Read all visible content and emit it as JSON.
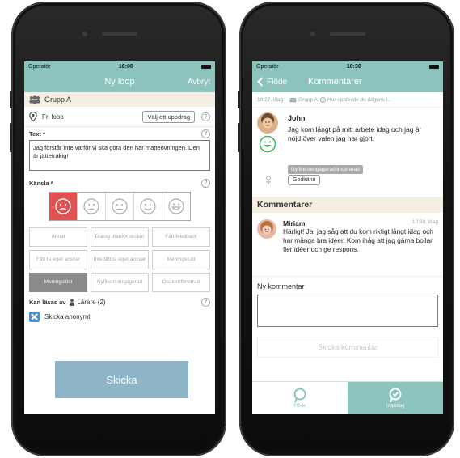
{
  "left": {
    "status": {
      "carrier": "Operatör",
      "time": "16:08"
    },
    "nav": {
      "title": "Ny loop",
      "cancel": "Avbryt"
    },
    "group": "Grupp A",
    "loop": {
      "label": "Fri loop",
      "choose_task": "Välj ett uppdrag",
      "help": "?"
    },
    "text_label": "Text *",
    "text_value": "Jag förstår inte varför vi ska göra den här matteövningen. Den är jätteträkig!",
    "feeling_label": "Känsla *",
    "feelings": [
      "Annat",
      "Dialog utanför skolan",
      "Fått feedback",
      "Fått ta eget ansvar",
      "Inte fått ta eget ansvar",
      "Meningsfullt",
      "Meningslöst",
      "Nyfiken/ engagerad",
      "Osäker/förvirrad"
    ],
    "readable_by_label": "Kan läsas av",
    "readable_by_value": "Lärare (2)",
    "anonymous": "Skicka anonymt",
    "send": "Skicka"
  },
  "right": {
    "status": {
      "carrier": "Operatör",
      "time": "10:30"
    },
    "nav": {
      "back": "Flöde",
      "title": "Kommentarer"
    },
    "meta": {
      "time": "10:27, idag",
      "group": "Grupp A",
      "question": "Hur upplevde du dagens l..."
    },
    "post": {
      "author": "John",
      "text": "Jag kom långt på mitt arbete idag och jag är nöjd över valen jag har gjort.",
      "tag": "Nyfiken/engagerad/inspirerad",
      "approve": "Godkänn"
    },
    "comments_header": "Kommentarer",
    "comment": {
      "author": "Miriam",
      "time": "10:30, idag",
      "text": "Härligt! Ja, jag såg att du kom riktigt långt idag och har många bra idéer. Kom ihåg att jag gärna bollar fler idéer och ge respons."
    },
    "new_comment_label": "Ny kommentar",
    "send_comment": "Skicka kommentar",
    "tabs": [
      {
        "label": "Flöde"
      },
      {
        "label": "Uppdrag"
      }
    ]
  },
  "colors": {
    "teal": "#8cc3bc",
    "beige": "#f5efe3",
    "red": "#e25050",
    "button_blue": "#8fb4c7",
    "green": "#3dbb5a"
  }
}
